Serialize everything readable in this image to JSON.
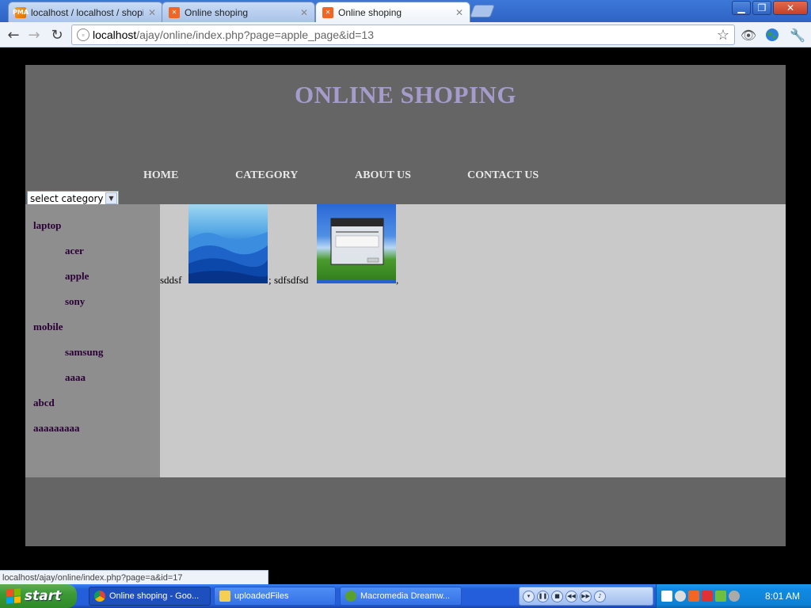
{
  "browser": {
    "tabs": [
      {
        "label": "localhost / localhost / shoping",
        "icon": "phpmyadmin-icon",
        "active": false
      },
      {
        "label": "Online shoping",
        "icon": "xampp-icon",
        "active": false
      },
      {
        "label": "Online shoping",
        "icon": "xampp-icon",
        "active": true
      }
    ],
    "address": {
      "host": "localhost",
      "path": "/ajay/online/index.php?page=apple_page&id=13"
    },
    "status_url": "localhost/ajay/online/index.php?page=a&id=17"
  },
  "site": {
    "title": "ONLINE SHOPING",
    "nav": [
      "HOME",
      "CATEGORY",
      "ABOUT US",
      "CONTACT US"
    ],
    "category_select": {
      "selected": "select category"
    },
    "sidebar": [
      {
        "label": "laptop",
        "level": 0
      },
      {
        "label": "acer",
        "level": 1
      },
      {
        "label": "apple",
        "level": 1
      },
      {
        "label": "sony",
        "level": 1
      },
      {
        "label": "mobile",
        "level": 0
      },
      {
        "label": "samsung",
        "level": 1
      },
      {
        "label": "aaaa",
        "level": 1
      },
      {
        "label": "abcd",
        "level": 0
      },
      {
        "label": "aaaaaaaaa",
        "level": 0
      }
    ],
    "products": [
      {
        "name": "sddsf",
        "image": "blue-mountains",
        "separator": ";"
      },
      {
        "name": "sdfsdfsd",
        "image": "windows-xp-desktop",
        "separator": ","
      }
    ]
  },
  "taskbar": {
    "start_label": "start",
    "items": [
      {
        "label": "Online shoping - Goo...",
        "icon": "chrome-icon",
        "pressed": true
      },
      {
        "label": "uploadedFiles",
        "icon": "folder-icon",
        "pressed": false
      },
      {
        "label": "Macromedia Dreamw...",
        "icon": "dreamweaver-icon",
        "pressed": false
      }
    ],
    "clock": "8:01 AM"
  }
}
